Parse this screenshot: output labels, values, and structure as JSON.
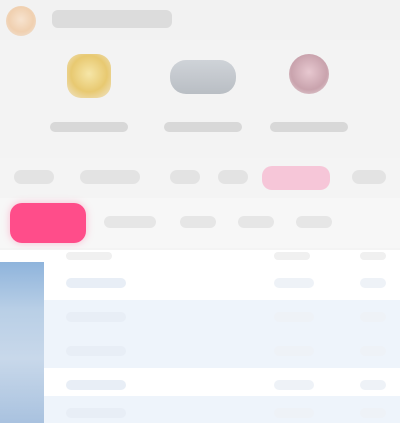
{
  "header": {
    "title": ""
  },
  "features": [
    {
      "label": "",
      "icon": "gold-badge-icon"
    },
    {
      "label": "",
      "icon": "card-icon"
    },
    {
      "label": "",
      "icon": "avatar-icon"
    }
  ],
  "filters": [
    "",
    "",
    "",
    "",
    "",
    ""
  ],
  "tabs": {
    "active": "",
    "others": [
      "",
      "",
      "",
      ""
    ]
  },
  "list": {
    "headers": [
      "",
      "",
      ""
    ],
    "rows": [
      {
        "name": "",
        "meta": "",
        "count": ""
      },
      {
        "name": "",
        "meta": "",
        "count": ""
      },
      {
        "name": "",
        "meta": "",
        "count": ""
      },
      {
        "name": "",
        "meta": "",
        "count": ""
      },
      {
        "name": "",
        "meta": "",
        "count": ""
      }
    ]
  },
  "colors": {
    "accent": "#ff4d8a",
    "row_alt": "#eef4fb",
    "sidebar": "#a9c2df"
  }
}
